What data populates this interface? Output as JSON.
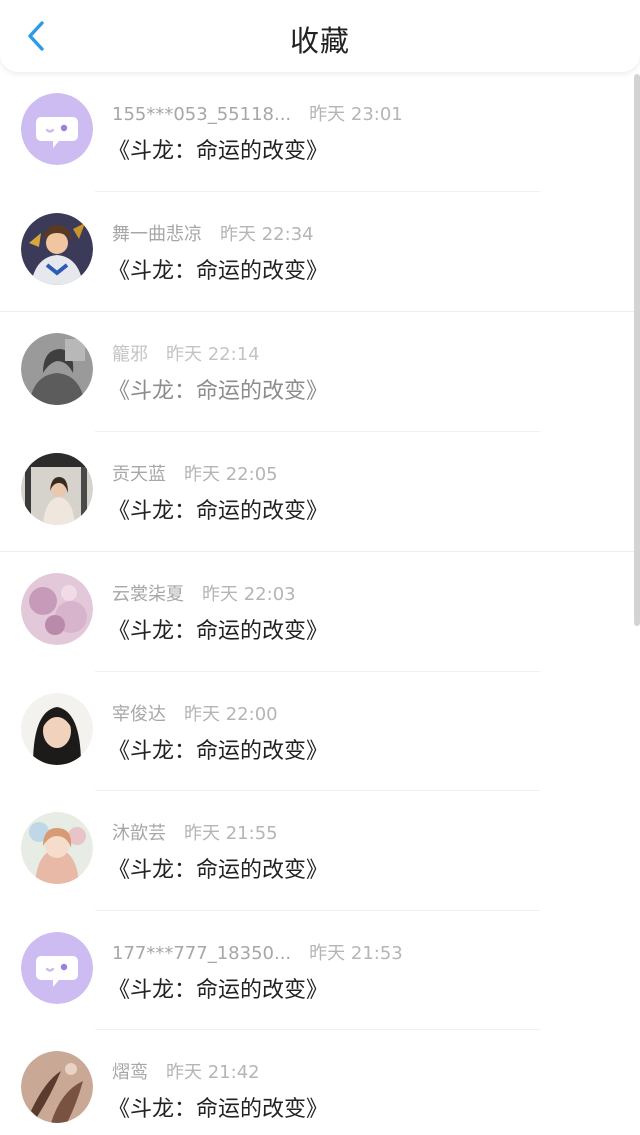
{
  "header": {
    "title": "收藏"
  },
  "colors": {
    "accent": "#2a9be8",
    "placeholder_avatar": "#cdbcf2"
  },
  "items": [
    {
      "name": "155***053_55118...",
      "time": "昨天 23:01",
      "work": "《斗龙：命运的改变》",
      "avatar_icon": "chat-bubble-icon"
    },
    {
      "name": "舞一曲悲凉",
      "time": "昨天 22:34",
      "work": "《斗龙：命运的改变》",
      "avatar_icon": "avatar-photo"
    },
    {
      "name": "籠邪",
      "time": "昨天 22:14",
      "work": "《斗龙：命运的改变》",
      "avatar_icon": "avatar-photo"
    },
    {
      "name": "贡天蓝",
      "time": "昨天 22:05",
      "work": "《斗龙：命运的改变》",
      "avatar_icon": "avatar-photo"
    },
    {
      "name": "云裳柒夏",
      "time": "昨天 22:03",
      "work": "《斗龙：命运的改变》",
      "avatar_icon": "avatar-photo"
    },
    {
      "name": "宰俊达",
      "time": "昨天 22:00",
      "work": "《斗龙：命运的改变》",
      "avatar_icon": "avatar-photo"
    },
    {
      "name": "沐歆芸",
      "time": "昨天 21:55",
      "work": "《斗龙：命运的改变》",
      "avatar_icon": "avatar-photo"
    },
    {
      "name": "177***777_18350...",
      "time": "昨天 21:53",
      "work": "《斗龙：命运的改变》",
      "avatar_icon": "chat-bubble-icon"
    },
    {
      "name": "熠鸾",
      "time": "昨天 21:42",
      "work": "《斗龙：命运的改变》",
      "avatar_icon": "avatar-photo"
    }
  ]
}
